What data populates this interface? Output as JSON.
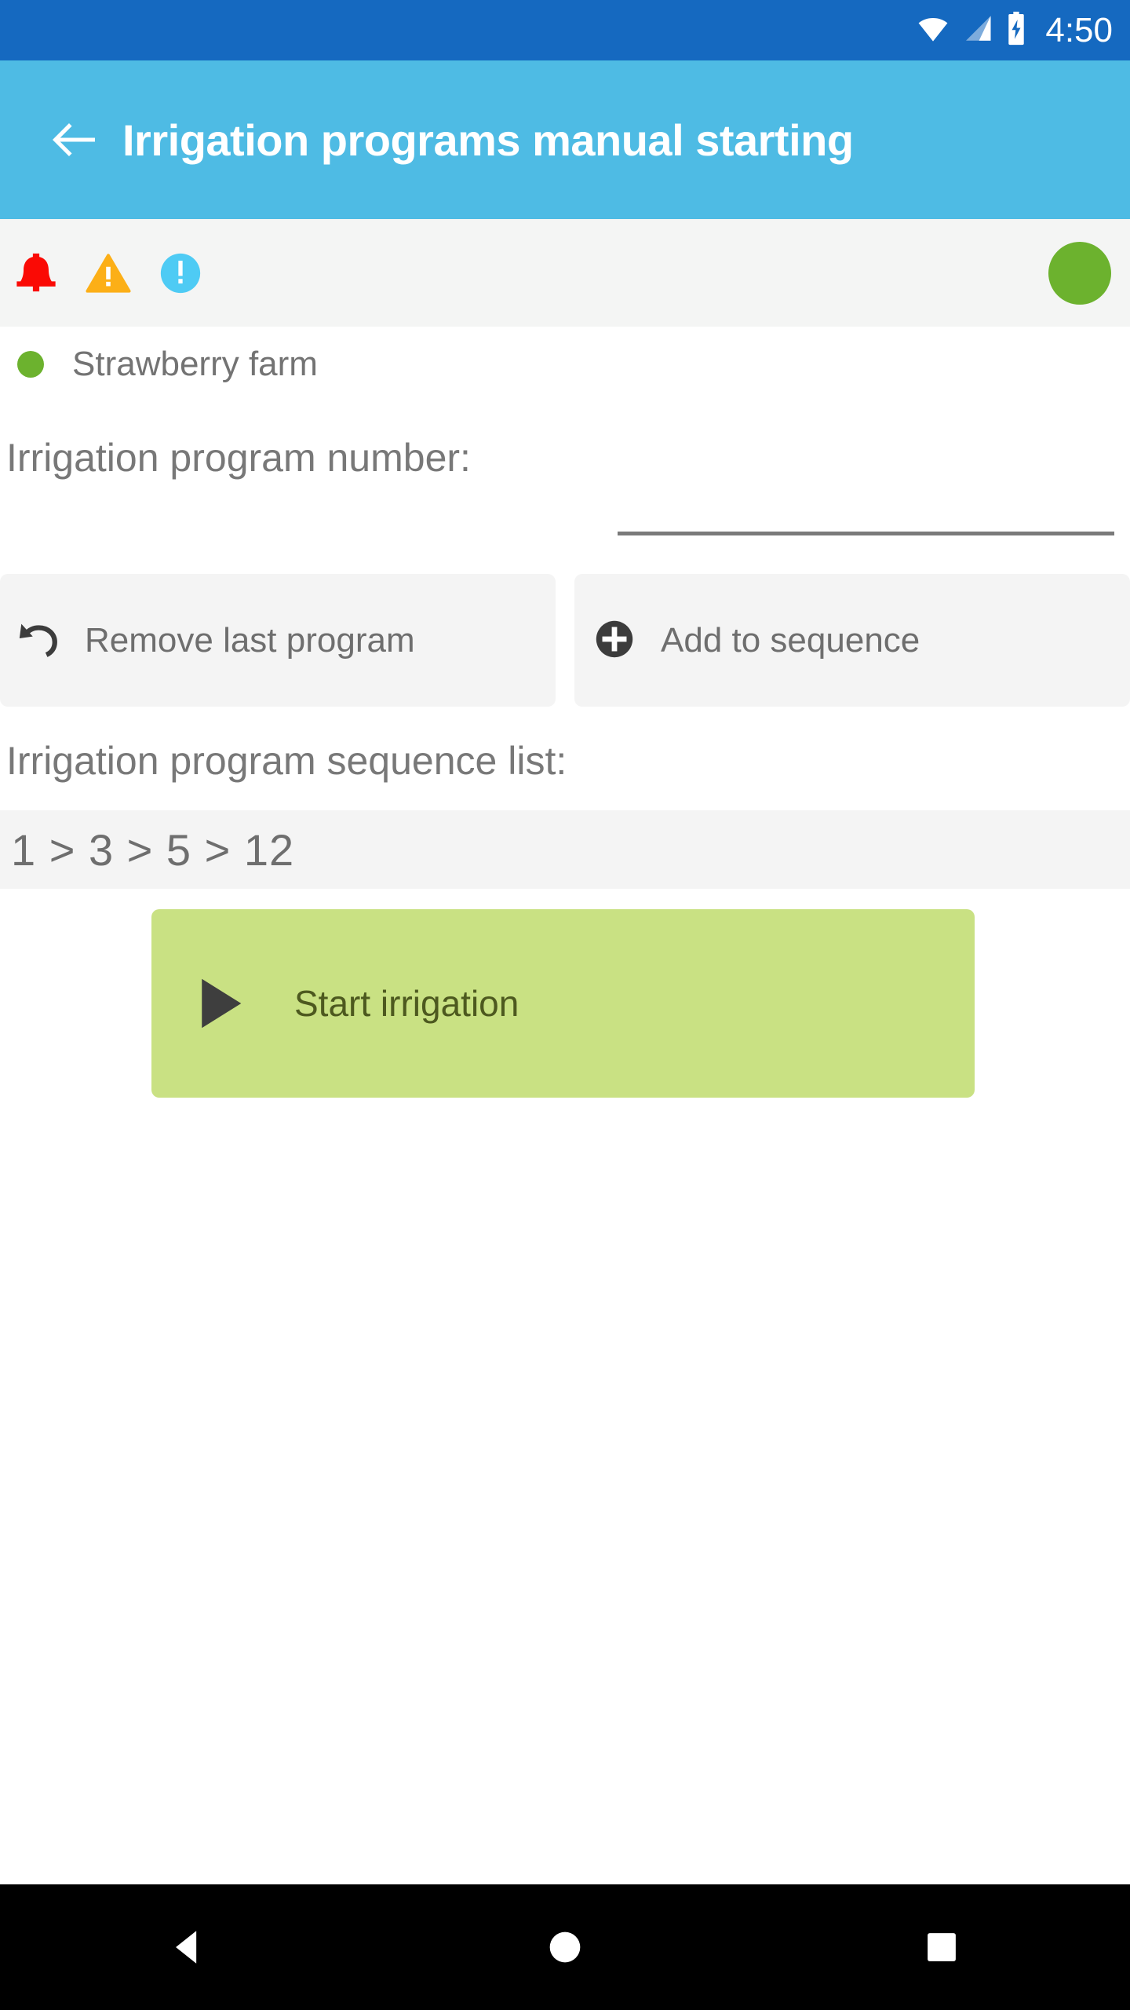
{
  "status_bar": {
    "clock": "4:50",
    "background": "#1569c0",
    "icons": [
      "wifi-icon",
      "cellular-signal-icon",
      "battery-charging-icon"
    ]
  },
  "app_bar": {
    "background": "#4ebbe4",
    "back_icon": "back-arrow-icon",
    "title": "Irrigation programs manual starting"
  },
  "alert_bar": {
    "background": "#f4f5f4",
    "icons": [
      {
        "name": "alarm-bell-icon",
        "color": "#fa0a05"
      },
      {
        "name": "warning-triangle-icon",
        "color": "#fcaf17"
      },
      {
        "name": "info-circle-icon",
        "color": "#4ecbf4"
      }
    ],
    "connection_status_color": "#6cb22e"
  },
  "site": {
    "status_color": "#6cb22e",
    "name": "Strawberry farm"
  },
  "form": {
    "program_number_label": "Irrigation program number:",
    "program_number_value": "",
    "program_number_placeholder": ""
  },
  "actions": {
    "remove_last": {
      "label": "Remove last program",
      "icon": "undo-arrow-icon"
    },
    "add_to_sequence": {
      "label": "Add to sequence",
      "icon": "plus-circle-icon"
    }
  },
  "sequence": {
    "label": "Irrigation program sequence list:",
    "value": "1 > 3 > 5 > 12",
    "items": [
      1,
      3,
      5,
      12
    ]
  },
  "start": {
    "label": "Start irrigation",
    "icon": "play-triangle-icon",
    "background": "#c9e183",
    "text_color": "#4d591f"
  },
  "nav_bar": {
    "background": "#000000",
    "buttons": [
      {
        "name": "nav-back-button",
        "icon": "triangle-left-icon"
      },
      {
        "name": "nav-home-button",
        "icon": "circle-icon"
      },
      {
        "name": "nav-recents-button",
        "icon": "square-icon"
      }
    ]
  }
}
